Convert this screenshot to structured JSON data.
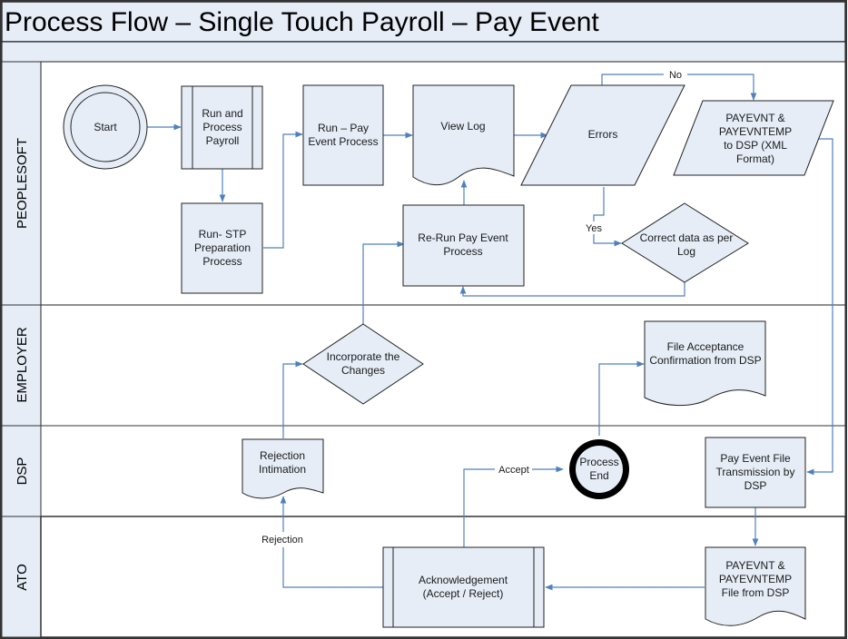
{
  "title": "Process Flow – Single Touch Payroll – Pay Event",
  "lanes": [
    {
      "id": "peoplesoft",
      "label": "PEOPLESOFT"
    },
    {
      "id": "employer",
      "label": "EMPLOYER"
    },
    {
      "id": "dsp",
      "label": "DSP"
    },
    {
      "id": "ato",
      "label": "ATO"
    }
  ],
  "nodes": {
    "start": {
      "lines": [
        "Start"
      ],
      "shape": "start-circle",
      "lane": "peoplesoft"
    },
    "run_process_payroll": {
      "lines": [
        "Run and",
        "Process",
        "Payroll"
      ],
      "shape": "predefined-process",
      "lane": "peoplesoft"
    },
    "run_stp_prep": {
      "lines": [
        "Run- STP",
        "Preparation",
        "Process"
      ],
      "shape": "process",
      "lane": "peoplesoft"
    },
    "run_pay_event": {
      "lines": [
        "Run – Pay",
        "Event Process"
      ],
      "shape": "process",
      "lane": "peoplesoft"
    },
    "view_log": {
      "lines": [
        "View Log"
      ],
      "shape": "document",
      "lane": "peoplesoft"
    },
    "rerun_pay_event": {
      "lines": [
        "Re-Run Pay Event",
        "Process"
      ],
      "shape": "process",
      "lane": "peoplesoft"
    },
    "errors": {
      "lines": [
        "Errors"
      ],
      "shape": "data",
      "lane": "peoplesoft"
    },
    "payevnt_to_dsp": {
      "lines": [
        "PAYEVNT &",
        "PAYEVNTEMP",
        "to DSP (XML",
        "Format)"
      ],
      "shape": "data",
      "lane": "peoplesoft"
    },
    "correct_data": {
      "lines": [
        "Correct data as per",
        "Log"
      ],
      "shape": "decision",
      "lane": "peoplesoft"
    },
    "incorporate_changes": {
      "lines": [
        "Incorporate the",
        "Changes"
      ],
      "shape": "decision",
      "lane": "employer"
    },
    "file_acceptance": {
      "lines": [
        "File Acceptance",
        "Confirmation from DSP"
      ],
      "shape": "document",
      "lane": "employer"
    },
    "rejection_intimation": {
      "lines": [
        "Rejection",
        "Intimation"
      ],
      "shape": "document",
      "lane": "dsp"
    },
    "process_end": {
      "lines": [
        "Process",
        "End"
      ],
      "shape": "end-circle",
      "lane": "dsp"
    },
    "pay_event_transmission": {
      "lines": [
        "Pay Event File",
        "Transmission by",
        "DSP"
      ],
      "shape": "process",
      "lane": "dsp"
    },
    "acknowledgement": {
      "lines": [
        "Acknowledgement",
        "(Accept / Reject)"
      ],
      "shape": "predefined-process",
      "lane": "ato"
    },
    "payevnt_file_from_dsp": {
      "lines": [
        "PAYEVNT &",
        "PAYEVNTEMP",
        "File from DSP"
      ],
      "shape": "document",
      "lane": "ato"
    }
  },
  "edges": [
    {
      "from": "start",
      "to": "run_process_payroll",
      "label": ""
    },
    {
      "from": "run_process_payroll",
      "to": "run_stp_prep",
      "label": ""
    },
    {
      "from": "run_stp_prep",
      "to": "run_pay_event",
      "label": ""
    },
    {
      "from": "run_pay_event",
      "to": "view_log",
      "label": ""
    },
    {
      "from": "view_log",
      "to": "errors",
      "label": ""
    },
    {
      "from": "errors",
      "to": "payevnt_to_dsp",
      "label": "No"
    },
    {
      "from": "errors",
      "to": "correct_data",
      "label": "Yes"
    },
    {
      "from": "correct_data",
      "to": "rerun_pay_event",
      "label": ""
    },
    {
      "from": "rerun_pay_event",
      "to": "view_log",
      "label": ""
    },
    {
      "from": "payevnt_to_dsp",
      "to": "pay_event_transmission",
      "label": ""
    },
    {
      "from": "pay_event_transmission",
      "to": "payevnt_file_from_dsp",
      "label": ""
    },
    {
      "from": "payevnt_file_from_dsp",
      "to": "acknowledgement",
      "label": ""
    },
    {
      "from": "acknowledgement",
      "to": "process_end",
      "label": "Accept"
    },
    {
      "from": "acknowledgement",
      "to": "rejection_intimation",
      "label": "Rejection"
    },
    {
      "from": "rejection_intimation",
      "to": "incorporate_changes",
      "label": ""
    },
    {
      "from": "incorporate_changes",
      "to": "rerun_pay_event",
      "label": ""
    },
    {
      "from": "process_end",
      "to": "file_acceptance",
      "label": ""
    }
  ],
  "colors": {
    "shape_fill": "#e6edf7",
    "lane_header_fill": "#e6edf7",
    "connector": "#4f81bd",
    "outline": "#222222"
  }
}
